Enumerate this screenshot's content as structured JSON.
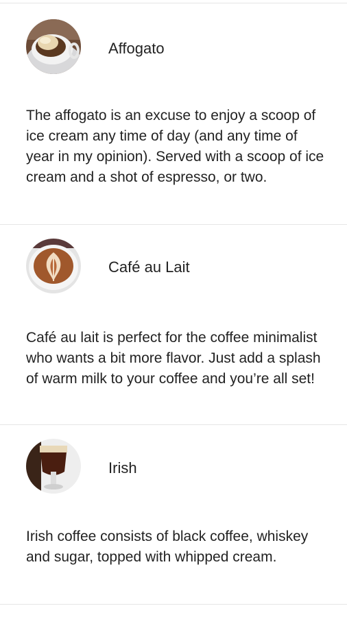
{
  "items": [
    {
      "name": "Affogato",
      "description": "The affogato is an excuse to enjoy a scoop of ice cream any time of day (and any time of year in my opinion). Served with a scoop of ice cream and a shot of espresso, or two.",
      "image_icon": "affogato-image"
    },
    {
      "name": "Café au Lait",
      "description": "Café au lait is perfect for the coffee minimalist who wants a bit more flavor. Just add a splash of warm milk to your coffee and you’re all set!",
      "image_icon": "cafe-au-lait-image"
    },
    {
      "name": "Irish",
      "description": "Irish coffee consists of black coffee, whiskey and sugar, topped with whipped cream.",
      "image_icon": "irish-coffee-image"
    }
  ]
}
